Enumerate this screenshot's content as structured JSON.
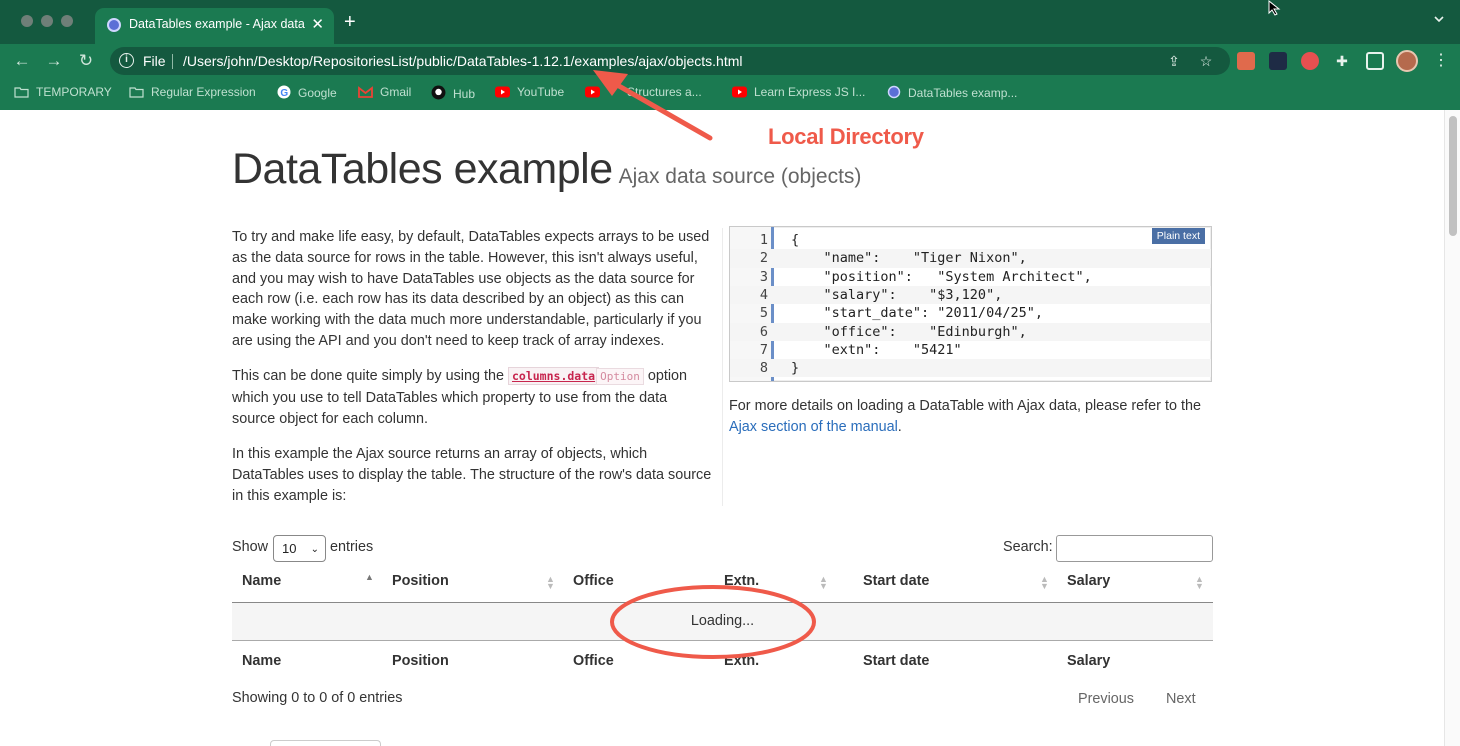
{
  "browser": {
    "tab": {
      "title": "DataTables example - Ajax data source (objects)",
      "favicon": "datatables-favicon"
    },
    "omnibox": {
      "scheme_label": "File",
      "url": "/Users/john/Desktop/RepositoriesList/public/DataTables-1.12.1/examples/ajax/objects.html"
    },
    "bookmarks": [
      {
        "label": "TEMPORARY",
        "icon": "folder-icon"
      },
      {
        "label": "Regular Expression",
        "icon": "folder-icon"
      },
      {
        "label": "Google",
        "icon": "google-icon"
      },
      {
        "label": "Gmail",
        "icon": "gmail-icon"
      },
      {
        "label": "Hub",
        "icon": "github-icon"
      },
      {
        "label": "YouTube",
        "icon": "youtube-icon"
      },
      {
        "label": "Structures a...",
        "icon": "youtube-icon"
      },
      {
        "label": "Learn Express JS I...",
        "icon": "youtube-icon"
      },
      {
        "label": "DataTables examp...",
        "icon": "datatables-favicon"
      }
    ]
  },
  "page": {
    "title": "DataTables example",
    "subtitle": "Ajax data source (objects)",
    "para1": "To try and make life easy, by default, DataTables expects arrays to be used as the data source for rows in the table. However, this isn't always useful, and you may wish to have DataTables use objects as the data source for each row (i.e. each row has its data described by an object) as this can make working with the data much more understandable, particularly if you are using the API and you don't need to keep track of array indexes.",
    "para2_before": "This can be done quite simply by using the ",
    "para2_code": "columns.data",
    "para2_tag": "Option",
    "para2_after": " option which you use to tell DataTables which property to use from the data source object for each column.",
    "para3": "In this example the Ajax source returns an array of objects, which DataTables uses to display the table. The structure of the row's data source in this example is:",
    "code_badge": "Plain text",
    "code_lines": [
      {
        "n": "1",
        "text": "{"
      },
      {
        "n": "2",
        "text": "    \"name\":    \"Tiger Nixon\","
      },
      {
        "n": "3",
        "text": "    \"position\":   \"System Architect\","
      },
      {
        "n": "4",
        "text": "    \"salary\":    \"$3,120\","
      },
      {
        "n": "5",
        "text": "    \"start_date\": \"2011/04/25\","
      },
      {
        "n": "6",
        "text": "    \"office\":    \"Edinburgh\","
      },
      {
        "n": "7",
        "text": "    \"extn\":    \"5421\""
      },
      {
        "n": "8",
        "text": "}"
      }
    ],
    "more_details_text": "For more details on loading a DataTable with Ajax data, please refer to the ",
    "more_details_link": "Ajax section of the manual",
    "more_details_end": "."
  },
  "table": {
    "show_label": "Show",
    "length_value": "10",
    "entries_label": "entries",
    "search_label": "Search:",
    "columns": [
      "Name",
      "Position",
      "Office",
      "Extn.",
      "Start date",
      "Salary"
    ],
    "loading": "Loading...",
    "info": "Showing 0 to 0 of 0 entries",
    "prev": "Previous",
    "next": "Next"
  },
  "annotations": {
    "arrow_label": "Local Directory",
    "color": "#ef5a4a"
  },
  "colors": {
    "chrome_dark": "#14593f",
    "chrome": "#1b7a51",
    "link": "#2a6dbb"
  }
}
